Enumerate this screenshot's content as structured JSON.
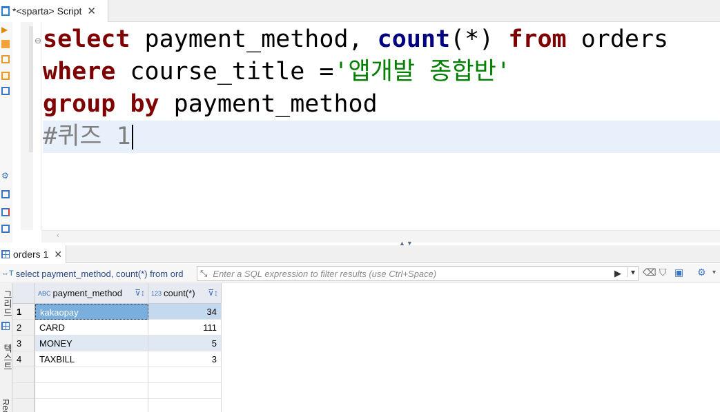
{
  "editor_tab": {
    "title": "*<sparta> Script",
    "close": "✕"
  },
  "code": {
    "line1": {
      "kw1": "select",
      "t1": " payment_method, ",
      "fn": "count",
      "t2": "(*) ",
      "kw2": "from",
      "t3": " orders"
    },
    "line2": {
      "kw": "where",
      "t1": " course_title =",
      "str": "'앱개발 종합반'"
    },
    "line3": {
      "kw1": "group",
      "kw2": "by",
      "t1": " payment_method"
    },
    "line4": {
      "comment": "#퀴즈 1"
    }
  },
  "results_tab": {
    "title": "orders 1",
    "close": "✕"
  },
  "filter": {
    "sql_text": "select payment_method, count(*) from ord",
    "placeholder": "Enter a SQL expression to filter results (use Ctrl+Space)"
  },
  "side_labels": {
    "grid": "그리드",
    "text": "텍스트",
    "record": "Record"
  },
  "table": {
    "columns": [
      {
        "type": "ABC",
        "name": "payment_method"
      },
      {
        "type": "123",
        "name": "count(*)"
      }
    ],
    "rows": [
      {
        "num": "1",
        "payment_method": "kakaopay",
        "count": "34"
      },
      {
        "num": "2",
        "payment_method": "CARD",
        "count": "111"
      },
      {
        "num": "3",
        "payment_method": "MONEY",
        "count": "5"
      },
      {
        "num": "4",
        "payment_method": "TAXBILL",
        "count": "3"
      }
    ]
  },
  "colors": {
    "keyword": "#7f0000",
    "function": "#000080",
    "string": "#008000",
    "comment": "#808080",
    "selection": "#7aaedc"
  }
}
